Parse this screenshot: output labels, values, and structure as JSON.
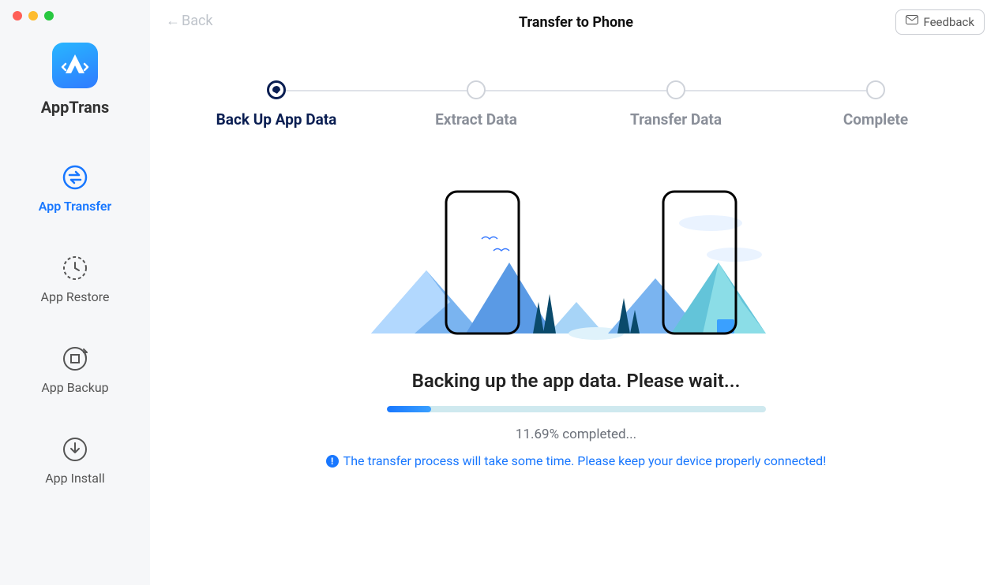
{
  "brand": "AppTrans",
  "sidebar": {
    "items": [
      {
        "label": "App Transfer",
        "icon": "transfer-icon",
        "active": true
      },
      {
        "label": "App Restore",
        "icon": "restore-icon",
        "active": false
      },
      {
        "label": "App Backup",
        "icon": "backup-icon",
        "active": false
      },
      {
        "label": "App Install",
        "icon": "install-icon",
        "active": false
      }
    ]
  },
  "header": {
    "back_label": "Back",
    "title": "Transfer to Phone",
    "feedback_label": "Feedback"
  },
  "stepper": {
    "steps": [
      {
        "label": "Back Up App Data",
        "state": "active"
      },
      {
        "label": "Extract Data",
        "state": "pending"
      },
      {
        "label": "Transfer Data",
        "state": "pending"
      },
      {
        "label": "Complete",
        "state": "pending"
      }
    ]
  },
  "status": {
    "title": "Backing up the app data. Please wait...",
    "progress_percent": 11.69,
    "progress_text": "11.69% completed...",
    "notice": "The transfer process will take some time. Please keep your device properly connected!"
  },
  "colors": {
    "accent": "#1877ff",
    "step_active": "#0a1e52",
    "muted": "#8a8f99"
  }
}
